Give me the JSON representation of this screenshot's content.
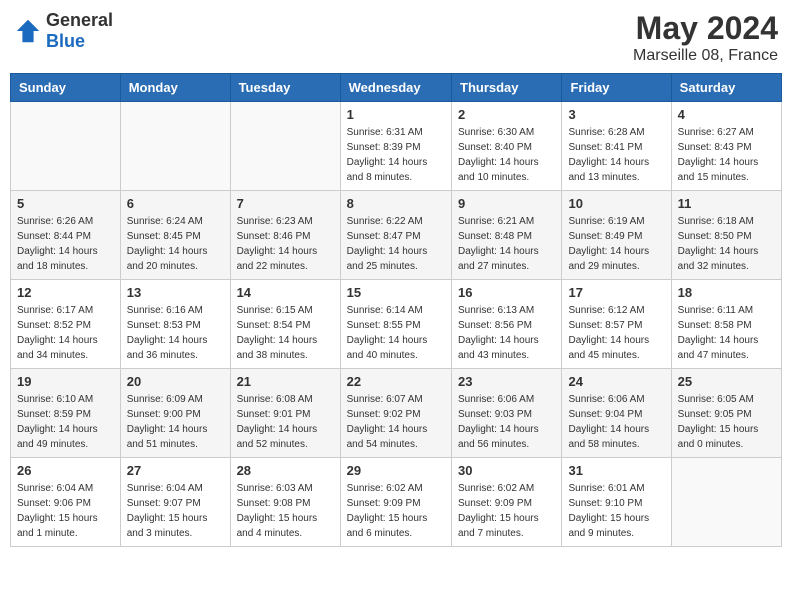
{
  "header": {
    "logo_general": "General",
    "logo_blue": "Blue",
    "month_title": "May 2024",
    "location": "Marseille 08, France"
  },
  "days_of_week": [
    "Sunday",
    "Monday",
    "Tuesday",
    "Wednesday",
    "Thursday",
    "Friday",
    "Saturday"
  ],
  "weeks": [
    [
      {
        "day": "",
        "info": ""
      },
      {
        "day": "",
        "info": ""
      },
      {
        "day": "",
        "info": ""
      },
      {
        "day": "1",
        "info": "Sunrise: 6:31 AM\nSunset: 8:39 PM\nDaylight: 14 hours\nand 8 minutes."
      },
      {
        "day": "2",
        "info": "Sunrise: 6:30 AM\nSunset: 8:40 PM\nDaylight: 14 hours\nand 10 minutes."
      },
      {
        "day": "3",
        "info": "Sunrise: 6:28 AM\nSunset: 8:41 PM\nDaylight: 14 hours\nand 13 minutes."
      },
      {
        "day": "4",
        "info": "Sunrise: 6:27 AM\nSunset: 8:43 PM\nDaylight: 14 hours\nand 15 minutes."
      }
    ],
    [
      {
        "day": "5",
        "info": "Sunrise: 6:26 AM\nSunset: 8:44 PM\nDaylight: 14 hours\nand 18 minutes."
      },
      {
        "day": "6",
        "info": "Sunrise: 6:24 AM\nSunset: 8:45 PM\nDaylight: 14 hours\nand 20 minutes."
      },
      {
        "day": "7",
        "info": "Sunrise: 6:23 AM\nSunset: 8:46 PM\nDaylight: 14 hours\nand 22 minutes."
      },
      {
        "day": "8",
        "info": "Sunrise: 6:22 AM\nSunset: 8:47 PM\nDaylight: 14 hours\nand 25 minutes."
      },
      {
        "day": "9",
        "info": "Sunrise: 6:21 AM\nSunset: 8:48 PM\nDaylight: 14 hours\nand 27 minutes."
      },
      {
        "day": "10",
        "info": "Sunrise: 6:19 AM\nSunset: 8:49 PM\nDaylight: 14 hours\nand 29 minutes."
      },
      {
        "day": "11",
        "info": "Sunrise: 6:18 AM\nSunset: 8:50 PM\nDaylight: 14 hours\nand 32 minutes."
      }
    ],
    [
      {
        "day": "12",
        "info": "Sunrise: 6:17 AM\nSunset: 8:52 PM\nDaylight: 14 hours\nand 34 minutes."
      },
      {
        "day": "13",
        "info": "Sunrise: 6:16 AM\nSunset: 8:53 PM\nDaylight: 14 hours\nand 36 minutes."
      },
      {
        "day": "14",
        "info": "Sunrise: 6:15 AM\nSunset: 8:54 PM\nDaylight: 14 hours\nand 38 minutes."
      },
      {
        "day": "15",
        "info": "Sunrise: 6:14 AM\nSunset: 8:55 PM\nDaylight: 14 hours\nand 40 minutes."
      },
      {
        "day": "16",
        "info": "Sunrise: 6:13 AM\nSunset: 8:56 PM\nDaylight: 14 hours\nand 43 minutes."
      },
      {
        "day": "17",
        "info": "Sunrise: 6:12 AM\nSunset: 8:57 PM\nDaylight: 14 hours\nand 45 minutes."
      },
      {
        "day": "18",
        "info": "Sunrise: 6:11 AM\nSunset: 8:58 PM\nDaylight: 14 hours\nand 47 minutes."
      }
    ],
    [
      {
        "day": "19",
        "info": "Sunrise: 6:10 AM\nSunset: 8:59 PM\nDaylight: 14 hours\nand 49 minutes."
      },
      {
        "day": "20",
        "info": "Sunrise: 6:09 AM\nSunset: 9:00 PM\nDaylight: 14 hours\nand 51 minutes."
      },
      {
        "day": "21",
        "info": "Sunrise: 6:08 AM\nSunset: 9:01 PM\nDaylight: 14 hours\nand 52 minutes."
      },
      {
        "day": "22",
        "info": "Sunrise: 6:07 AM\nSunset: 9:02 PM\nDaylight: 14 hours\nand 54 minutes."
      },
      {
        "day": "23",
        "info": "Sunrise: 6:06 AM\nSunset: 9:03 PM\nDaylight: 14 hours\nand 56 minutes."
      },
      {
        "day": "24",
        "info": "Sunrise: 6:06 AM\nSunset: 9:04 PM\nDaylight: 14 hours\nand 58 minutes."
      },
      {
        "day": "25",
        "info": "Sunrise: 6:05 AM\nSunset: 9:05 PM\nDaylight: 15 hours\nand 0 minutes."
      }
    ],
    [
      {
        "day": "26",
        "info": "Sunrise: 6:04 AM\nSunset: 9:06 PM\nDaylight: 15 hours\nand 1 minute."
      },
      {
        "day": "27",
        "info": "Sunrise: 6:04 AM\nSunset: 9:07 PM\nDaylight: 15 hours\nand 3 minutes."
      },
      {
        "day": "28",
        "info": "Sunrise: 6:03 AM\nSunset: 9:08 PM\nDaylight: 15 hours\nand 4 minutes."
      },
      {
        "day": "29",
        "info": "Sunrise: 6:02 AM\nSunset: 9:09 PM\nDaylight: 15 hours\nand 6 minutes."
      },
      {
        "day": "30",
        "info": "Sunrise: 6:02 AM\nSunset: 9:09 PM\nDaylight: 15 hours\nand 7 minutes."
      },
      {
        "day": "31",
        "info": "Sunrise: 6:01 AM\nSunset: 9:10 PM\nDaylight: 15 hours\nand 9 minutes."
      },
      {
        "day": "",
        "info": ""
      }
    ]
  ]
}
